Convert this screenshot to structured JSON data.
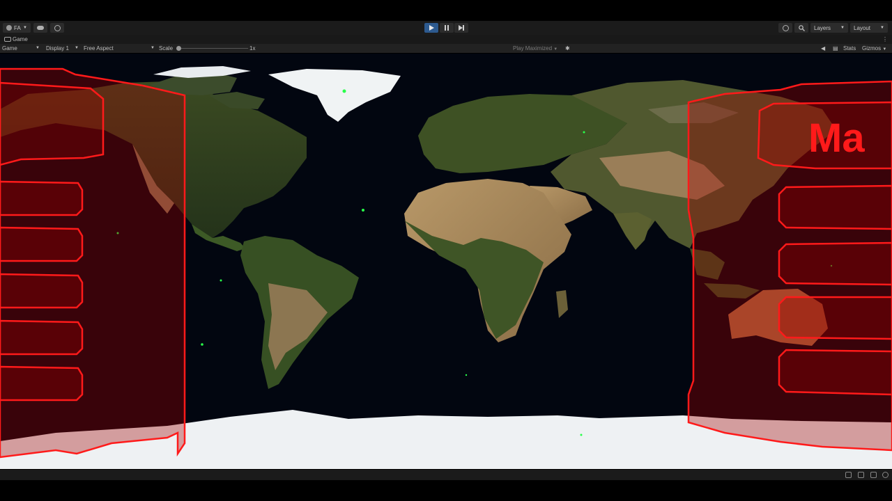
{
  "toolbar": {
    "account_label": "FA",
    "account_icon": "account-icon",
    "cloud_icon": "cloud-icon",
    "collab_icon": "collab-icon",
    "play_icon": "play-icon",
    "pause_icon": "pause-icon",
    "step_icon": "step-icon",
    "history_icon": "history-icon",
    "search_icon": "search-icon",
    "layers_label": "Layers",
    "layout_label": "Layout",
    "play_active_color": "#2d5a8f"
  },
  "tab": {
    "title": "Game",
    "icon": "gamepad-icon"
  },
  "game_toolbar": {
    "view_label": "Game",
    "display_label": "Display 1",
    "aspect_label": "Free Aspect",
    "scale_label": "Scale",
    "scale_value": "1x",
    "scale_level": 0.0,
    "play_maximized_label": "Play Maximized",
    "stats_label": "Stats",
    "gizmos_label": "Gizmos"
  },
  "game_view": {
    "partial_title": "Ma",
    "hud_color": "#ff1a1a",
    "ocean_color": "#020610"
  },
  "status_bar": {
    "icons": [
      "debug-icon",
      "console-icon",
      "progress-icon",
      "settings-icon"
    ]
  }
}
